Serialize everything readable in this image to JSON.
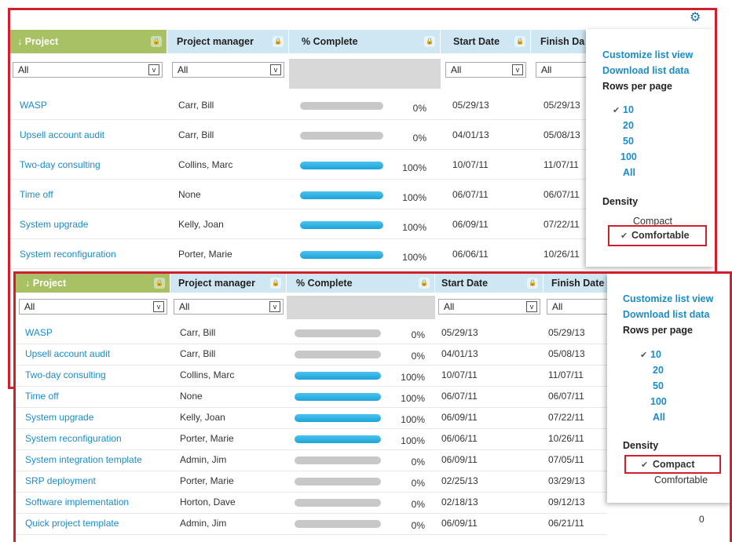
{
  "columns": {
    "project": "Project",
    "manager": "Project manager",
    "complete": "% Complete",
    "start": "Start Date",
    "finish_cut": "Finish Da",
    "finish": "Finish Date"
  },
  "filters": {
    "all": "All"
  },
  "sort_glyph": "↓",
  "dropdown_glyph": "v",
  "rows": [
    {
      "project": "WASP",
      "manager": "Carr, Bill",
      "pct": "0%",
      "progress": 0,
      "start": "05/29/13",
      "finish": "05/29/13"
    },
    {
      "project": "Upsell account audit",
      "manager": "Carr, Bill",
      "pct": "0%",
      "progress": 0,
      "start": "04/01/13",
      "finish": "05/08/13"
    },
    {
      "project": "Two-day consulting",
      "manager": "Collins, Marc",
      "pct": "100%",
      "progress": 1,
      "start": "10/07/11",
      "finish": "11/07/11"
    },
    {
      "project": "Time off",
      "manager": "None",
      "pct": "100%",
      "progress": 1,
      "start": "06/07/11",
      "finish": "06/07/11"
    },
    {
      "project": "System upgrade",
      "manager": "Kelly, Joan",
      "pct": "100%",
      "progress": 1,
      "start": "06/09/11",
      "finish": "07/22/11"
    },
    {
      "project": "System reconfiguration",
      "manager": "Porter, Marie",
      "pct": "100%",
      "progress": 1,
      "start": "06/06/11",
      "finish": "10/26/11"
    },
    {
      "project": "System integration template",
      "manager": "Admin, Jim",
      "pct": "0%",
      "progress": 0,
      "start": "06/09/11",
      "finish": "07/05/11"
    },
    {
      "project": "SRP deployment",
      "manager": "Porter, Marie",
      "pct": "0%",
      "progress": 0,
      "start": "02/25/13",
      "finish": "03/29/13"
    },
    {
      "project": "Software implementation",
      "manager": "Horton, Dave",
      "pct": "0%",
      "progress": 0,
      "start": "02/18/13",
      "finish": "09/12/13"
    },
    {
      "project": "Quick project template",
      "manager": "Admin, Jim",
      "pct": "0%",
      "progress": 0,
      "start": "06/09/11",
      "finish": "06/21/11"
    }
  ],
  "last_row_extra": "0",
  "menu": {
    "customize": "Customize list view",
    "download": "Download list data",
    "rows_per_page": "Rows per page",
    "rpp_options": [
      "10",
      "20",
      "50",
      "100",
      "All"
    ],
    "density": "Density",
    "compact": "Compact",
    "comfortable": "Comfortable",
    "check": "✔"
  },
  "colors": {
    "accent": "#1b8bc9",
    "header_green": "#a8c164",
    "header_blue": "#cfe7f3",
    "highlight": "#d0202e"
  }
}
